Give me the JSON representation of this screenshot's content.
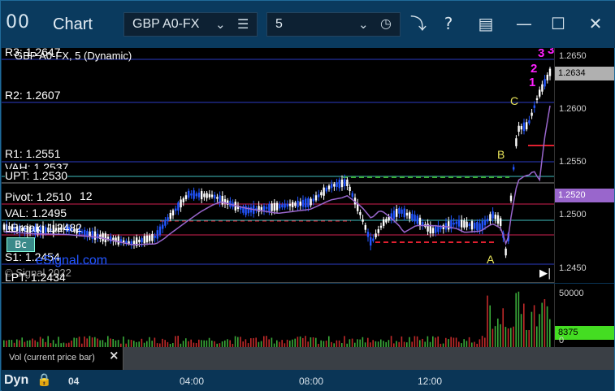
{
  "window": {
    "logo": "00",
    "title": "Chart",
    "symbol": "GBP A0-FX",
    "interval": "5",
    "icons": {
      "symbol_caret": "chevron-down-icon",
      "symbol_list": "list-icon",
      "interval_caret": "chevron-down-icon",
      "interval_clock": "clock-icon",
      "link": "link-icon",
      "help": "help-icon",
      "template": "template-icon",
      "minimize": "minimize-icon",
      "maximize": "maximize-icon",
      "close": "close-icon"
    }
  },
  "chart": {
    "caption": "GBP A0-FX, 5 (Dynamic)",
    "copyright": "© Signal 2022",
    "watermark": "eSignal.com",
    "signal_tag": "Bc",
    "levels": {
      "r3": "R3: 1.2647",
      "r2": "R2: 1.2607",
      "r1": "R1: 1.2551",
      "vah": "VAH: 1.2537",
      "upt": "UPT: 1.2530",
      "pivot": "Pivot: 1.2510",
      "pivot_suffix": "12",
      "val": "VAL: 1.2495",
      "lbreak": "LBreak: 1.2482",
      "s1": "S1: 1.2454",
      "lpt": "LPT: 1.2434"
    },
    "annotations": {
      "a1": "A",
      "a2": "A",
      "b": "B",
      "c": "C"
    },
    "counts": [
      "1",
      "2",
      "3",
      "3"
    ],
    "price_axis": {
      "ticks": [
        "1.2650",
        "1.2600",
        "1.2550",
        "1.2500",
        "1.2450"
      ],
      "current_price": "1.2634",
      "ma_price": "1.2520"
    },
    "colors": {
      "background": "#000000",
      "up_candle": "#ffffff",
      "down_candle": "#2255ff",
      "moving_average": "#9966cc",
      "pivot_line": "#d02050",
      "support_line": "#2b3cc4",
      "value_area": "#40c0c0",
      "td_count": "#3a9a3a",
      "count_magenta": "#ff20ff",
      "annotation": "#e7e35a"
    }
  },
  "volume": {
    "axis_top": "50000",
    "current": "8375",
    "zero": "0",
    "tab_label": "Vol (current price bar)",
    "close": "×"
  },
  "time_axis": {
    "mode": "Dyn",
    "labels": [
      "04",
      "04:00",
      "08:00",
      "12:00"
    ]
  }
}
